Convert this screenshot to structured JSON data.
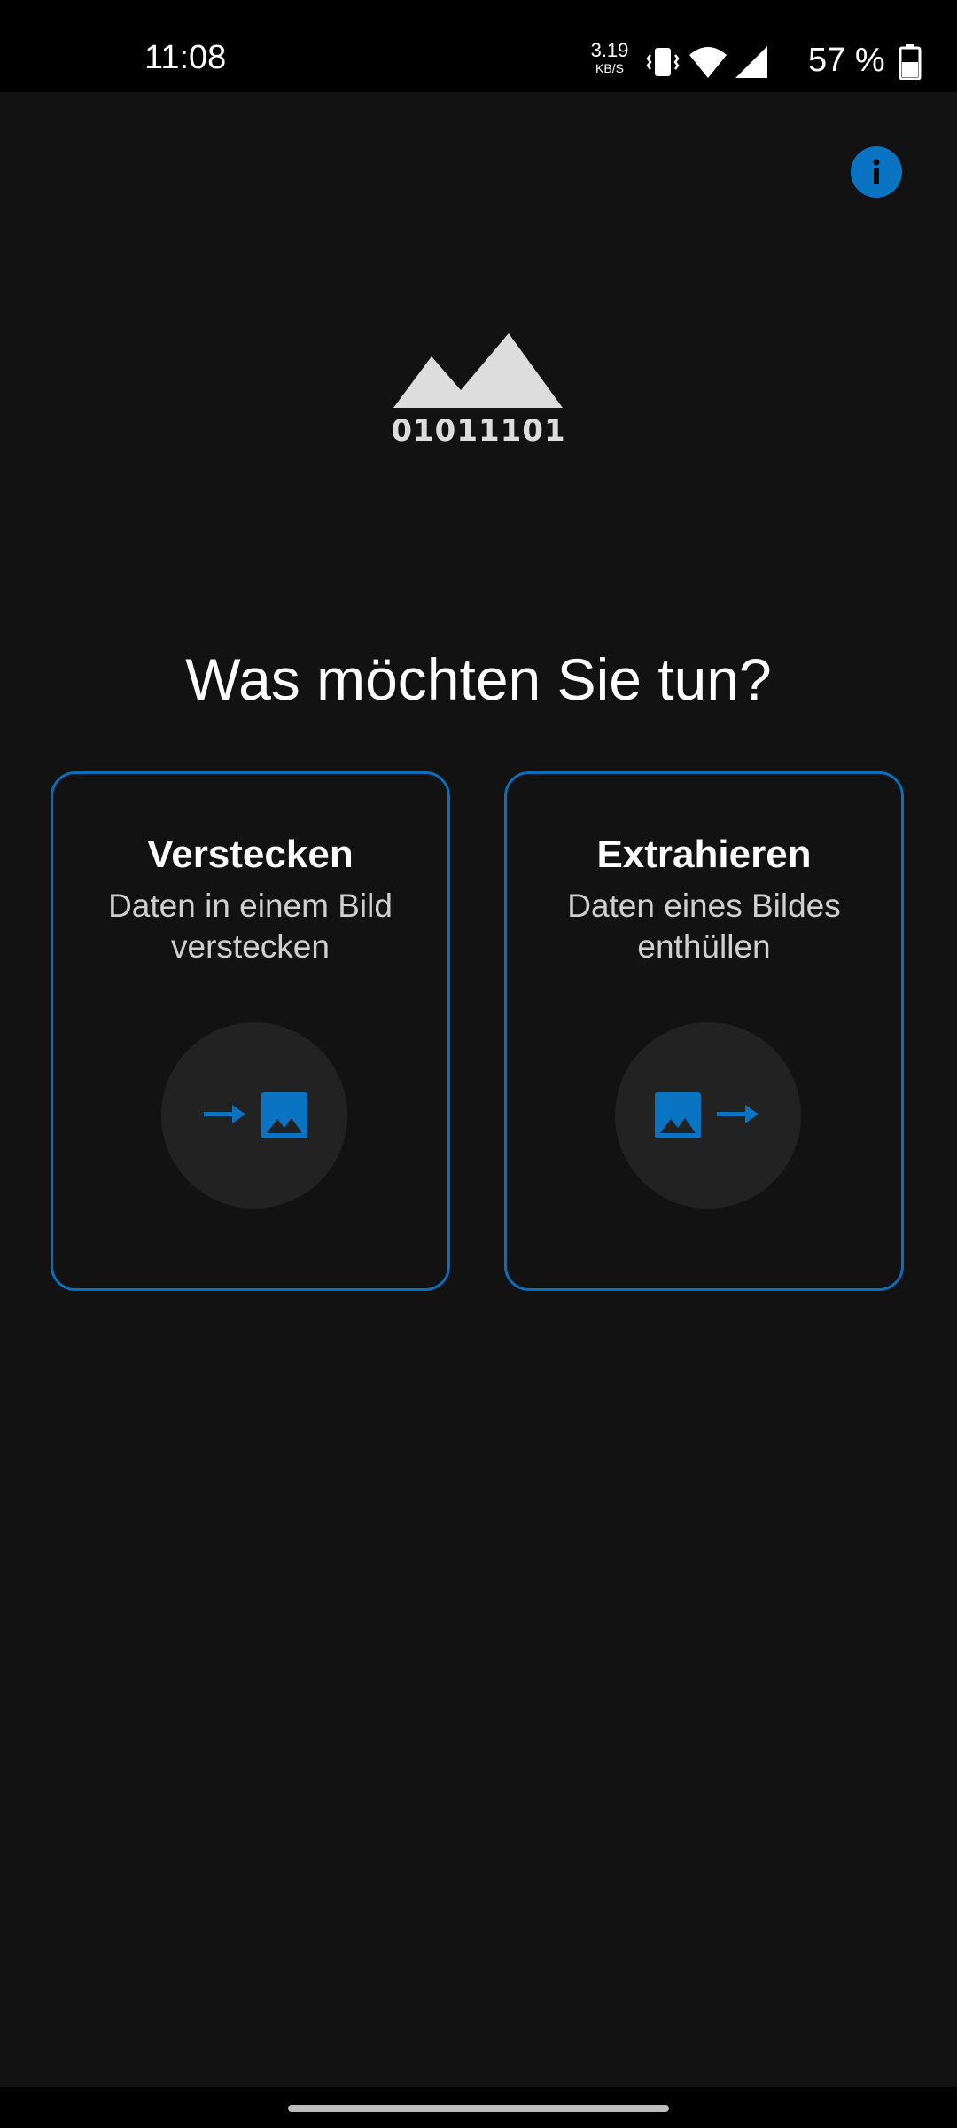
{
  "status_bar": {
    "time": "11:08",
    "net_speed_value": "3.19",
    "net_speed_unit": "KB/S",
    "battery_text": "57 %",
    "icons": [
      "vibrate-icon",
      "wifi-icon",
      "cell-signal-icon",
      "battery-icon"
    ]
  },
  "header": {
    "info_icon": "info-icon"
  },
  "logo": {
    "binary_text": "01011101"
  },
  "main": {
    "heading": "Was möchten Sie tun?",
    "cards": [
      {
        "title": "Verstecken",
        "description": "Daten in einem Bild verstecken",
        "icon": "arrow-into-image-icon"
      },
      {
        "title": "Extrahieren",
        "description": "Daten eines Bildes enthüllen",
        "icon": "image-arrow-out-icon"
      }
    ]
  },
  "colors": {
    "background": "#121212",
    "accent": "#0a73c2",
    "card_border": "#0a6fb8",
    "icon_circle": "#222222"
  }
}
